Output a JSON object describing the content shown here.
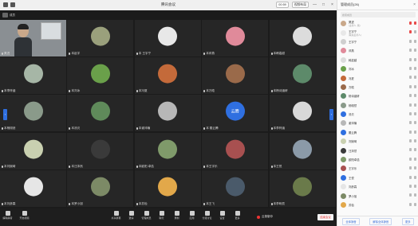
{
  "window": {
    "title": "腾讯会议",
    "chips": [
      "00:59",
      "视频布局"
    ],
    "controls": [
      "—",
      "□",
      "×"
    ]
  },
  "strip": {
    "label": "成员"
  },
  "tiles": [
    {
      "name": "昊进",
      "type": "video",
      "color": "#8a8f93"
    },
    {
      "name": "本赵宇",
      "type": "avatar",
      "color": "#9aa07c"
    },
    {
      "name": "本 王宇宁",
      "type": "avatar",
      "color": "#e8e8e8"
    },
    {
      "name": "本邓燕",
      "type": "avatar",
      "color": "#e08a9a"
    },
    {
      "name": "本韩嘉越",
      "type": "avatar",
      "color": "#dcdcdc"
    },
    {
      "name": "本李梓涵",
      "type": "avatar",
      "color": "#a6b6a6"
    },
    {
      "name": "本刘冰",
      "type": "avatar",
      "color": "#6aa04a"
    },
    {
      "name": "本冯夏",
      "type": "avatar",
      "color": "#c46a3a"
    },
    {
      "name": "本万晗",
      "type": "avatar",
      "color": "#9a6a4a"
    },
    {
      "name": "本杨诗涵研",
      "type": "avatar",
      "color": "#5d8a6a"
    },
    {
      "name": "本杨栩然",
      "type": "avatar",
      "color": "#8a9a8a"
    },
    {
      "name": "本汤贝",
      "type": "avatar",
      "color": "#5f8a5a"
    },
    {
      "name": "本谢沛楠",
      "type": "avatar",
      "color": "#b7b7b7"
    },
    {
      "name": "本 戴云腾",
      "type": "initial",
      "color": "#2f6fe0",
      "initial": "云腾"
    },
    {
      "name": "本李梓涵",
      "type": "avatar",
      "color": "#d8d8d8"
    },
    {
      "name": "本刘婉琦",
      "type": "avatar",
      "color": "#c9d0b0"
    },
    {
      "name": "本汪沐然",
      "type": "avatar",
      "color": "#3a3a3a"
    },
    {
      "name": "本欧阳 卓浩",
      "type": "avatar",
      "color": "#7f9a6a"
    },
    {
      "name": "本王宇乐",
      "type": "avatar",
      "color": "#a85050"
    },
    {
      "name": "本王悦",
      "type": "avatar",
      "color": "#8b9aa8"
    },
    {
      "name": "本刘彦霖",
      "type": "avatar",
      "color": "#e6e6e6"
    },
    {
      "name": "本罗小旭",
      "type": "avatar",
      "color": "#7c8a66"
    },
    {
      "name": "本苏怡",
      "type": "avatar",
      "color": "#e2a84a"
    },
    {
      "name": "本王飞",
      "type": "avatar",
      "color": "#4a5a6a"
    },
    {
      "name": "本李昕辰",
      "type": "avatar",
      "color": "#6a7a4a"
    }
  ],
  "pagers": {
    "left": "‹",
    "right": "›"
  },
  "toolbar": {
    "left": [
      {
        "label": "解除静音",
        "icon": "microphone-icon"
      },
      {
        "label": "开启视频",
        "icon": "camera-icon"
      }
    ],
    "center": [
      {
        "label": "共享屏幕",
        "icon": "share-screen-icon"
      },
      {
        "label": "邀请",
        "icon": "invite-icon"
      },
      {
        "label": "管理成员",
        "icon": "members-icon"
      },
      {
        "label": "聊天",
        "icon": "chat-icon"
      },
      {
        "label": "录制",
        "icon": "record-icon"
      },
      {
        "label": "应用",
        "icon": "apps-icon"
      },
      {
        "label": "分组讨论",
        "icon": "breakout-icon"
      },
      {
        "label": "设置",
        "icon": "gear-icon"
      },
      {
        "label": "更多",
        "icon": "more-icon"
      }
    ],
    "recording_label": "云录制中",
    "end_label": "结束会议"
  },
  "panel": {
    "title": "管理成员(26)",
    "search_placeholder": "搜索成员",
    "members": [
      {
        "name": "昊进",
        "sub": "(主持人, 我)",
        "color": "#c9a88a",
        "icons": [
          "red",
          "red"
        ]
      },
      {
        "name": "王宇宁",
        "sub": "(联席主持人)",
        "color": "#e8e8e8",
        "icons": [
          "red",
          "grey"
        ]
      },
      {
        "name": "王宇宁",
        "sub": "",
        "color": "#cfcfcf",
        "icons": [
          "grey",
          "grey"
        ]
      },
      {
        "name": "邓燕",
        "sub": "",
        "color": "#e08a9a",
        "icons": [
          "grey",
          "grey"
        ]
      },
      {
        "name": "韩嘉越",
        "sub": "",
        "color": "#dcdcdc",
        "icons": [
          "grey",
          "grey"
        ]
      },
      {
        "name": "刘冰",
        "sub": "",
        "color": "#6aa04a",
        "icons": [
          "grey",
          "grey"
        ]
      },
      {
        "name": "冯夏",
        "sub": "",
        "color": "#c46a3a",
        "icons": [
          "grey",
          "grey"
        ]
      },
      {
        "name": "万晗",
        "sub": "",
        "color": "#9a6a4a",
        "icons": [
          "grey",
          "grey"
        ]
      },
      {
        "name": "杨诗涵研",
        "sub": "",
        "color": "#5d8a6a",
        "icons": [
          "grey",
          "grey"
        ]
      },
      {
        "name": "杨栩然",
        "sub": "",
        "color": "#8a9a8a",
        "icons": [
          "grey",
          "grey"
        ]
      },
      {
        "name": "汤贝",
        "sub": "",
        "color": "#2f6fe0",
        "icons": [
          "grey",
          "grey"
        ]
      },
      {
        "name": "谢沛楠",
        "sub": "",
        "color": "#b7b7b7",
        "icons": [
          "grey",
          "grey"
        ]
      },
      {
        "name": "戴云腾",
        "sub": "",
        "color": "#2f6fe0",
        "icons": [
          "grey",
          "grey"
        ]
      },
      {
        "name": "刘婉琦",
        "sub": "",
        "color": "#c9d0b0",
        "icons": [
          "grey",
          "grey"
        ]
      },
      {
        "name": "汪沐然",
        "sub": "",
        "color": "#3a3a3a",
        "icons": [
          "grey",
          "grey"
        ]
      },
      {
        "name": "欧阳卓浩",
        "sub": "",
        "color": "#7f9a6a",
        "icons": [
          "grey",
          "grey"
        ]
      },
      {
        "name": "王宇乐",
        "sub": "",
        "color": "#a85050",
        "icons": [
          "grey",
          "grey"
        ]
      },
      {
        "name": "王悦",
        "sub": "",
        "color": "#2f6fe0",
        "icons": [
          "grey",
          "grey"
        ]
      },
      {
        "name": "刘彦霖",
        "sub": "",
        "color": "#e6e6e6",
        "icons": [
          "grey",
          "grey"
        ]
      },
      {
        "name": "罗小旭",
        "sub": "",
        "color": "#7c8a66",
        "icons": [
          "grey",
          "grey"
        ]
      },
      {
        "name": "苏怡",
        "sub": "",
        "color": "#e2a84a",
        "icons": [
          "grey",
          "grey"
        ]
      }
    ],
    "footer": [
      "全体静音",
      "解除全体静音",
      "更多"
    ]
  }
}
